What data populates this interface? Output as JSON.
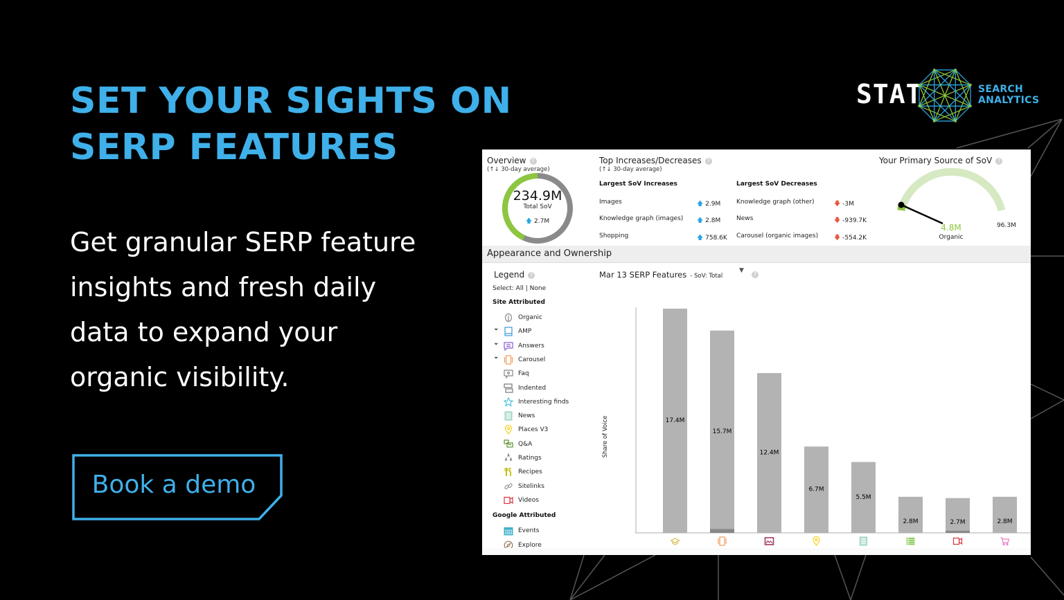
{
  "hero": {
    "headline_line1": "SET YOUR SIGHTS ON",
    "headline_line2": "SERP FEATURES",
    "subtext_lines": [
      "Get granular SERP feature",
      "insights and fresh daily",
      "data to expand your",
      "organic visibility."
    ],
    "cta_label": "Book a demo"
  },
  "logo": {
    "wordmark": "STAT",
    "tagline_line1": "SEARCH",
    "tagline_line2": "ANALYTICS"
  },
  "colors": {
    "accent_blue": "#3fb0e9",
    "logo_green": "#8dc63f",
    "gauge_green": "#8dc63f",
    "gauge_track": "#d6e9c2",
    "bar_gray": "#b3b3b3",
    "increase": "#29a6e0",
    "decrease": "#e8553d"
  },
  "overview": {
    "title": "Overview",
    "subtitle": "(↑↓ 30-day average)",
    "total_value": "234.9M",
    "total_label": "Total SoV",
    "change": "2.7M",
    "donut_fraction_green": 0.43
  },
  "top_changes": {
    "title": "Top Increases/Decreases",
    "subtitle": "(↑↓ 30-day average)",
    "increases_title": "Largest SoV Increases",
    "decreases_title": "Largest SoV Decreases",
    "increases": [
      {
        "name": "Images",
        "value": "2.9M"
      },
      {
        "name": "Knowledge graph (images)",
        "value": "2.8M"
      },
      {
        "name": "Shopping",
        "value": "758.6K"
      }
    ],
    "decreases": [
      {
        "name": "Knowledge graph (other)",
        "value": "-3M"
      },
      {
        "name": "News",
        "value": "-939.7K"
      },
      {
        "name": "Carousel (organic images)",
        "value": "-554.2K"
      }
    ]
  },
  "primary_source": {
    "title": "Your Primary Source of SoV",
    "value": "4.8M",
    "label": "Organic",
    "max": "96.3M",
    "fraction": 0.05
  },
  "appearance": {
    "section_title": "Appearance and Ownership",
    "legend_title": "Legend",
    "select_prefix": "Select:",
    "select_all": "All",
    "select_sep": "|",
    "select_none": "None",
    "chart_title": "Mar 13 SERP Features",
    "chart_metric": "- SoV: Total",
    "groups": [
      {
        "title": "Site Attributed",
        "items": [
          {
            "label": "Organic",
            "icon": "leaf-icon",
            "expandable": false
          },
          {
            "label": "AMP",
            "icon": "amp-icon",
            "expandable": true
          },
          {
            "label": "Answers",
            "icon": "answers-icon",
            "expandable": true
          },
          {
            "label": "Carousel",
            "icon": "carousel-icon",
            "expandable": true
          },
          {
            "label": "Faq",
            "icon": "faq-icon",
            "expandable": false
          },
          {
            "label": "Indented",
            "icon": "indented-icon",
            "expandable": false
          },
          {
            "label": "Interesting finds",
            "icon": "star-icon",
            "expandable": false
          },
          {
            "label": "News",
            "icon": "news-icon",
            "expandable": false
          },
          {
            "label": "Places V3",
            "icon": "map-pin-icon",
            "expandable": false
          },
          {
            "label": "Q&A",
            "icon": "qa-icon",
            "expandable": false
          },
          {
            "label": "Ratings",
            "icon": "ratings-icon",
            "expandable": false
          },
          {
            "label": "Recipes",
            "icon": "recipes-icon",
            "expandable": false
          },
          {
            "label": "Sitelinks",
            "icon": "link-icon",
            "expandable": false
          },
          {
            "label": "Videos",
            "icon": "video-icon",
            "expandable": false
          }
        ]
      },
      {
        "title": "Google Attributed",
        "items": [
          {
            "label": "Events",
            "icon": "calendar-icon",
            "expandable": false
          },
          {
            "label": "Explore",
            "icon": "compass-icon",
            "expandable": false
          }
        ]
      }
    ]
  },
  "chart_data": {
    "type": "bar",
    "title": "Mar 13 SERP Features - SoV: Total",
    "xlabel": "",
    "ylabel": "Share of Voice",
    "categories": [
      "knowledge-panel",
      "carousel",
      "images",
      "places",
      "news",
      "list",
      "videos",
      "shopping"
    ],
    "category_icons": [
      "graduation-cap-icon",
      "carousel-icon",
      "image-icon",
      "map-pin-icon",
      "news-icon",
      "list-icon",
      "video-icon",
      "cart-icon"
    ],
    "category_colors": [
      "#d9b84a",
      "#f39a5b",
      "#a03a64",
      "#f5d21c",
      "#8fd0bd",
      "#7cc242",
      "#d9323a",
      "#e87bc6"
    ],
    "values": [
      17.4,
      15.7,
      12.4,
      6.7,
      5.5,
      2.8,
      2.7,
      2.8
    ],
    "labels": [
      "17.4M",
      "15.7M",
      "12.4M",
      "6.7M",
      "5.5M",
      "2.8M",
      "2.7M",
      "2.8M"
    ],
    "owned_values": [
      0,
      0.3,
      0,
      0,
      0,
      0,
      0.05,
      0
    ],
    "units": "M",
    "ylim": [
      0,
      17.4
    ],
    "grid": false
  }
}
